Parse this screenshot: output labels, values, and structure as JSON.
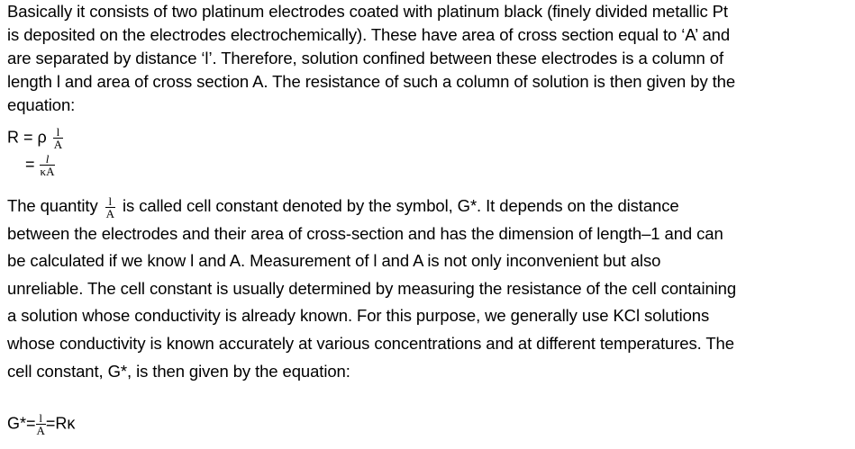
{
  "paragraph1": {
    "lines": [
      "Basically it consists of two platinum electrodes coated with platinum black (finely divided metallic Pt",
      "is deposited on the electrodes electrochemically). These have area of cross section equal to ‘A’ and",
      "are separated by distance ‘l’. Therefore, solution confined between these electrodes is a column of",
      "length l and area of cross section A. The resistance of such a column of solution is then given by the",
      "equation:"
    ]
  },
  "equation1": {
    "lhs": "R = ρ",
    "num": "l",
    "den": "A"
  },
  "equation2": {
    "lhs": "=",
    "num": "l",
    "den": "κA"
  },
  "paragraph2": {
    "line1_prefix": "The quantity ",
    "line1_frac_num": "l",
    "line1_frac_den": "A",
    "line1_suffix": " is called cell constant denoted by the symbol, G*. It depends on the distance",
    "lines": [
      "between the electrodes and their area of cross-section and has the dimension of length–1 and can",
      "be calculated if we know l and A. Measurement of l and A is not only inconvenient but also",
      "unreliable. The cell constant is usually determined by measuring the resistance of the cell containing",
      "a solution whose conductivity is already known. For this purpose, we generally use KCl solutions",
      "whose conductivity is known accurately at various concentrations and at different temperatures. The",
      "cell constant, G*, is then given by the equation:"
    ]
  },
  "equation3": {
    "lhs": "G*=",
    "num": "l",
    "den": "A",
    "rhs": "=Rκ"
  }
}
